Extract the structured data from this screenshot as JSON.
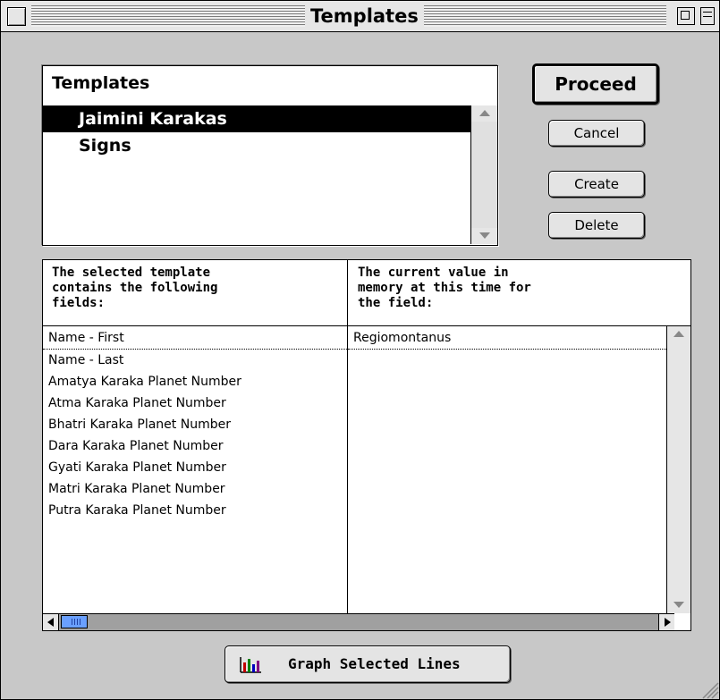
{
  "window": {
    "title": "Templates"
  },
  "templates": {
    "header": "Templates",
    "items": [
      {
        "label": "Jaimini Karakas",
        "selected": true
      },
      {
        "label": "Signs",
        "selected": false
      }
    ]
  },
  "buttons": {
    "proceed": "Proceed",
    "cancel": "Cancel",
    "create": "Create",
    "delete": "Delete",
    "graph": "Graph Selected Lines"
  },
  "fields_table": {
    "col1_header": [
      "The selected template",
      "contains the following",
      "fields:"
    ],
    "col2_header": [
      "The current value in",
      "memory at this time for",
      "the field:"
    ],
    "rows": [
      {
        "field": "Name - First",
        "value": "Regiomontanus"
      },
      {
        "field": "Name - Last",
        "value": ""
      },
      {
        "field": "Amatya Karaka Planet Number",
        "value": ""
      },
      {
        "field": "Atma Karaka Planet Number",
        "value": ""
      },
      {
        "field": "Bhatri Karaka Planet Number",
        "value": ""
      },
      {
        "field": "Dara Karaka Planet Number",
        "value": ""
      },
      {
        "field": "Gyati Karaka Planet Number",
        "value": ""
      },
      {
        "field": "Matri Karaka Planet Number",
        "value": ""
      },
      {
        "field": "Putra Karaka Planet Number",
        "value": ""
      }
    ]
  },
  "icons": {
    "graph": "bar-chart-icon",
    "close": "close-box-icon",
    "zoom": "zoom-box-icon",
    "collapse": "collapse-box-icon",
    "grow": "size-box-icon"
  },
  "colors": {
    "window_bg": "#c8c8c8",
    "selection": "#000000",
    "scroll_thumb": "#6aa0ff"
  }
}
